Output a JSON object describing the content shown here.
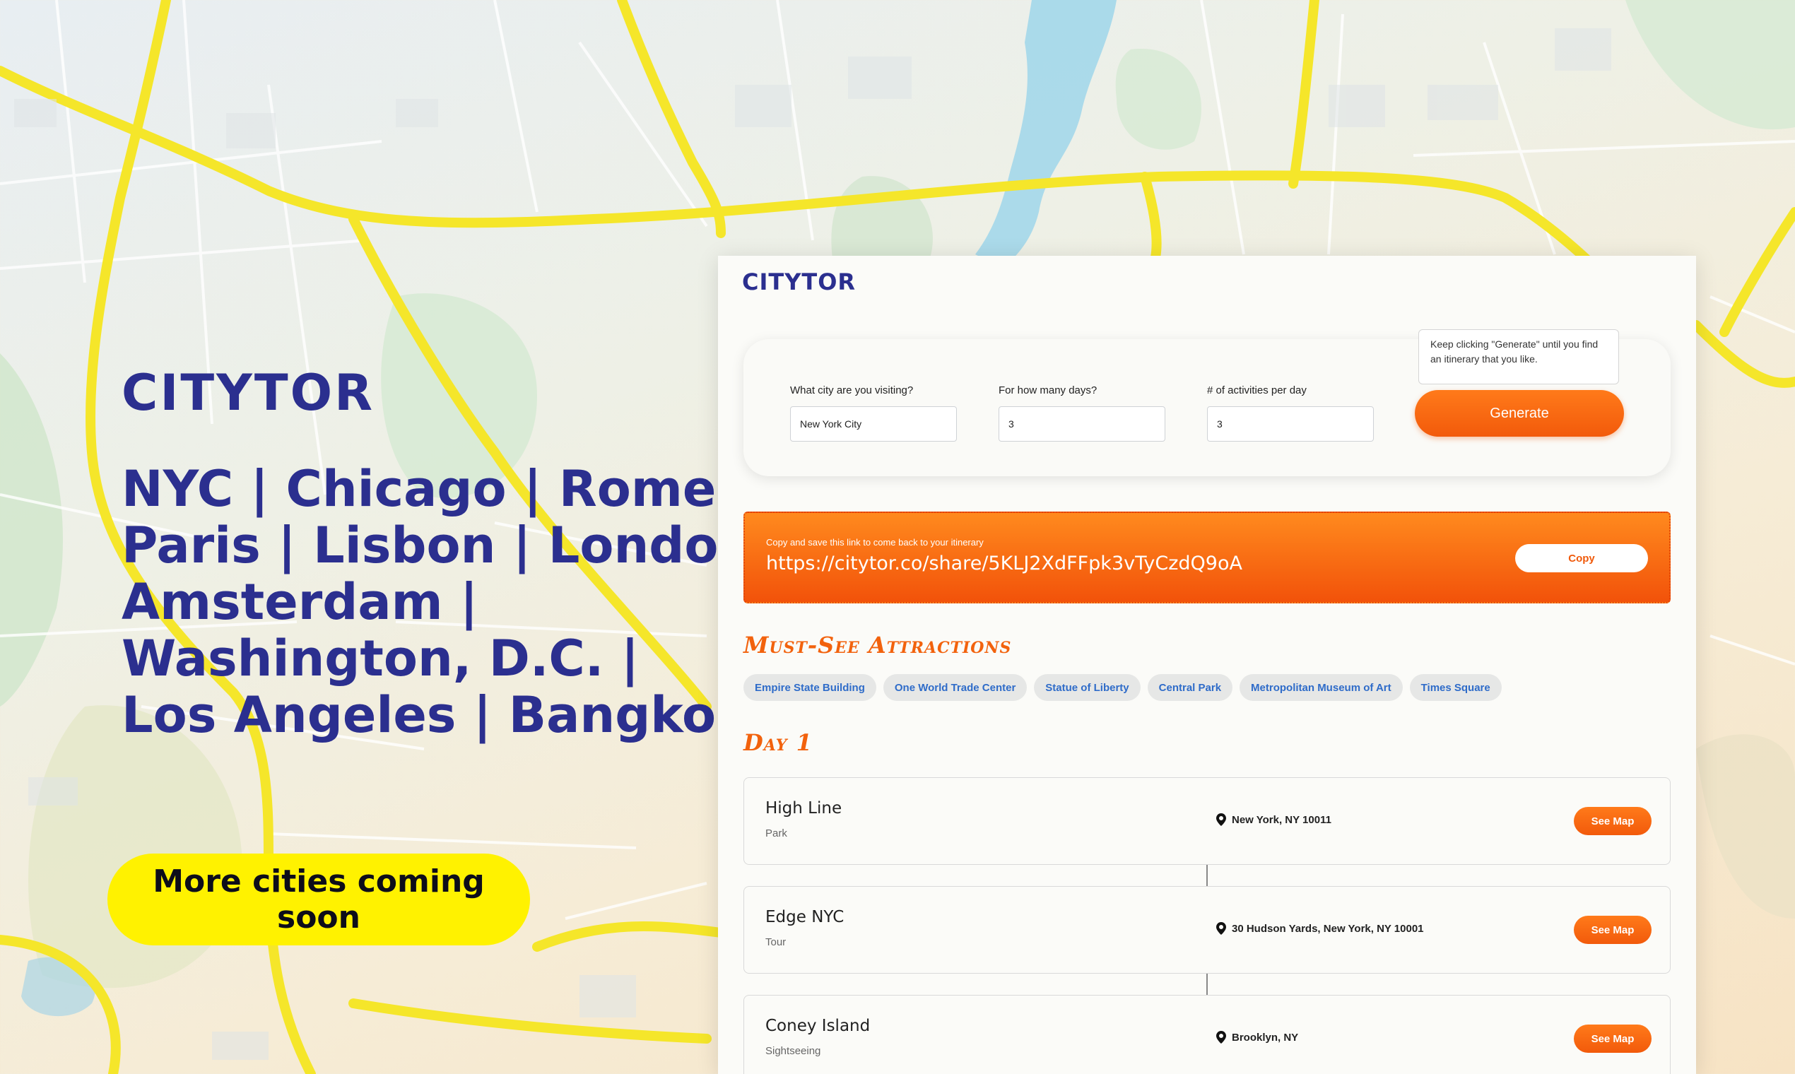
{
  "hero": {
    "logo": "CITYTOR",
    "city_lines": [
      "NYC | Chicago | Rome",
      "Paris | Lisbon | London",
      "Amsterdam |",
      "Washington, D.C. |",
      "Los Angeles | Bangkok"
    ],
    "cta_label": "More cities coming soon"
  },
  "app": {
    "logo": "CITYTOR",
    "form": {
      "city_label": "What city are you visiting?",
      "city_value": "New York City",
      "days_label": "For how many days?",
      "days_value": "3",
      "activities_label": "# of activities per day",
      "activities_value": "3",
      "tooltip": "Keep clicking \"Generate\" until you find an itinerary that you like.",
      "generate_label": "Generate"
    },
    "share": {
      "hint": "Copy and save this link to come back to your itinerary",
      "url": "https://citytor.co/share/5KLJ2XdFFpk3vTyCzdQ9oA",
      "copy_label": "Copy"
    },
    "attractions_title": "Must-See Attractions",
    "attractions": [
      "Empire State Building",
      "One World Trade Center",
      "Statue of Liberty",
      "Central Park",
      "Metropolitan Museum of Art",
      "Times Square"
    ],
    "day_title": "Day 1",
    "activities": [
      {
        "name": "High Line",
        "type": "Park",
        "address": "New York, NY 10011",
        "map_label": "See Map"
      },
      {
        "name": "Edge NYC",
        "type": "Tour",
        "address": "30 Hudson Yards, New York, NY 10001",
        "map_label": "See Map"
      },
      {
        "name": "Coney Island",
        "type": "Sightseeing",
        "address": "Brooklyn, NY",
        "map_label": "See Map"
      }
    ]
  },
  "colors": {
    "brand_blue": "#2b2f8f",
    "accent_orange": "#f2620d",
    "cta_yellow": "#fff200",
    "chip_text": "#2f6cc9",
    "road_yellow": "#f5e62a"
  },
  "icons": [
    "map-pin-icon"
  ]
}
